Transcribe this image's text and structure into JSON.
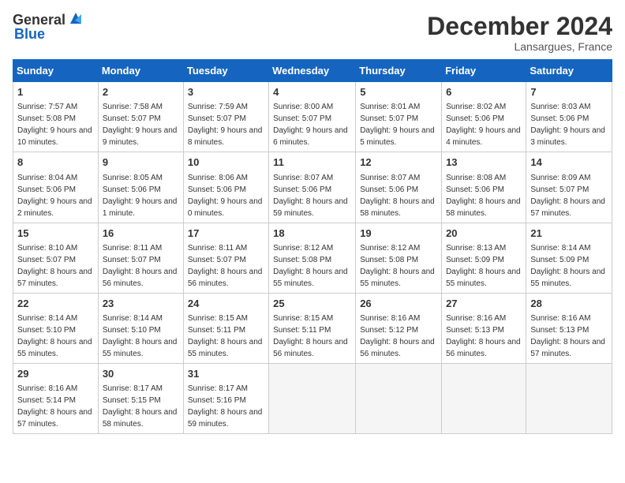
{
  "header": {
    "logo_general": "General",
    "logo_blue": "Blue",
    "title": "December 2024",
    "location": "Lansargues, France"
  },
  "days_of_week": [
    "Sunday",
    "Monday",
    "Tuesday",
    "Wednesday",
    "Thursday",
    "Friday",
    "Saturday"
  ],
  "weeks": [
    [
      {
        "day": "1",
        "sunrise": "7:57 AM",
        "sunset": "5:08 PM",
        "daylight": "9 hours and 10 minutes."
      },
      {
        "day": "2",
        "sunrise": "7:58 AM",
        "sunset": "5:07 PM",
        "daylight": "9 hours and 9 minutes."
      },
      {
        "day": "3",
        "sunrise": "7:59 AM",
        "sunset": "5:07 PM",
        "daylight": "9 hours and 8 minutes."
      },
      {
        "day": "4",
        "sunrise": "8:00 AM",
        "sunset": "5:07 PM",
        "daylight": "9 hours and 6 minutes."
      },
      {
        "day": "5",
        "sunrise": "8:01 AM",
        "sunset": "5:07 PM",
        "daylight": "9 hours and 5 minutes."
      },
      {
        "day": "6",
        "sunrise": "8:02 AM",
        "sunset": "5:06 PM",
        "daylight": "9 hours and 4 minutes."
      },
      {
        "day": "7",
        "sunrise": "8:03 AM",
        "sunset": "5:06 PM",
        "daylight": "9 hours and 3 minutes."
      }
    ],
    [
      {
        "day": "8",
        "sunrise": "8:04 AM",
        "sunset": "5:06 PM",
        "daylight": "9 hours and 2 minutes."
      },
      {
        "day": "9",
        "sunrise": "8:05 AM",
        "sunset": "5:06 PM",
        "daylight": "9 hours and 1 minute."
      },
      {
        "day": "10",
        "sunrise": "8:06 AM",
        "sunset": "5:06 PM",
        "daylight": "9 hours and 0 minutes."
      },
      {
        "day": "11",
        "sunrise": "8:07 AM",
        "sunset": "5:06 PM",
        "daylight": "8 hours and 59 minutes."
      },
      {
        "day": "12",
        "sunrise": "8:07 AM",
        "sunset": "5:06 PM",
        "daylight": "8 hours and 58 minutes."
      },
      {
        "day": "13",
        "sunrise": "8:08 AM",
        "sunset": "5:06 PM",
        "daylight": "8 hours and 58 minutes."
      },
      {
        "day": "14",
        "sunrise": "8:09 AM",
        "sunset": "5:07 PM",
        "daylight": "8 hours and 57 minutes."
      }
    ],
    [
      {
        "day": "15",
        "sunrise": "8:10 AM",
        "sunset": "5:07 PM",
        "daylight": "8 hours and 57 minutes."
      },
      {
        "day": "16",
        "sunrise": "8:11 AM",
        "sunset": "5:07 PM",
        "daylight": "8 hours and 56 minutes."
      },
      {
        "day": "17",
        "sunrise": "8:11 AM",
        "sunset": "5:07 PM",
        "daylight": "8 hours and 56 minutes."
      },
      {
        "day": "18",
        "sunrise": "8:12 AM",
        "sunset": "5:08 PM",
        "daylight": "8 hours and 55 minutes."
      },
      {
        "day": "19",
        "sunrise": "8:12 AM",
        "sunset": "5:08 PM",
        "daylight": "8 hours and 55 minutes."
      },
      {
        "day": "20",
        "sunrise": "8:13 AM",
        "sunset": "5:09 PM",
        "daylight": "8 hours and 55 minutes."
      },
      {
        "day": "21",
        "sunrise": "8:14 AM",
        "sunset": "5:09 PM",
        "daylight": "8 hours and 55 minutes."
      }
    ],
    [
      {
        "day": "22",
        "sunrise": "8:14 AM",
        "sunset": "5:10 PM",
        "daylight": "8 hours and 55 minutes."
      },
      {
        "day": "23",
        "sunrise": "8:14 AM",
        "sunset": "5:10 PM",
        "daylight": "8 hours and 55 minutes."
      },
      {
        "day": "24",
        "sunrise": "8:15 AM",
        "sunset": "5:11 PM",
        "daylight": "8 hours and 55 minutes."
      },
      {
        "day": "25",
        "sunrise": "8:15 AM",
        "sunset": "5:11 PM",
        "daylight": "8 hours and 56 minutes."
      },
      {
        "day": "26",
        "sunrise": "8:16 AM",
        "sunset": "5:12 PM",
        "daylight": "8 hours and 56 minutes."
      },
      {
        "day": "27",
        "sunrise": "8:16 AM",
        "sunset": "5:13 PM",
        "daylight": "8 hours and 56 minutes."
      },
      {
        "day": "28",
        "sunrise": "8:16 AM",
        "sunset": "5:13 PM",
        "daylight": "8 hours and 57 minutes."
      }
    ],
    [
      {
        "day": "29",
        "sunrise": "8:16 AM",
        "sunset": "5:14 PM",
        "daylight": "8 hours and 57 minutes."
      },
      {
        "day": "30",
        "sunrise": "8:17 AM",
        "sunset": "5:15 PM",
        "daylight": "8 hours and 58 minutes."
      },
      {
        "day": "31",
        "sunrise": "8:17 AM",
        "sunset": "5:16 PM",
        "daylight": "8 hours and 59 minutes."
      },
      null,
      null,
      null,
      null
    ]
  ]
}
